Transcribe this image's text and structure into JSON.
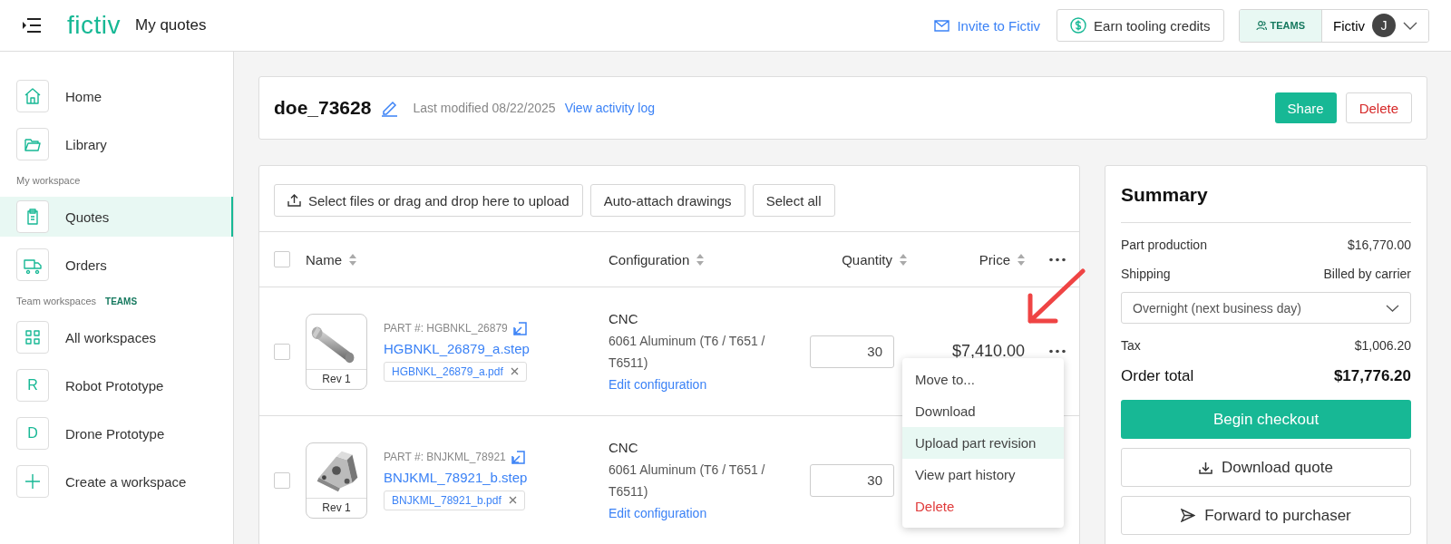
{
  "header": {
    "logo": "fictiv",
    "page_title": "My quotes",
    "invite_link": "Invite to Fictiv",
    "credits_button": "Earn tooling credits",
    "teams_badge": "TEAMS",
    "account_name": "Fictiv",
    "avatar_initial": "J"
  },
  "sidebar": [
    {
      "kind": "home",
      "label": "Home",
      "selected": false
    },
    {
      "kind": "library",
      "label": "Library",
      "selected": false
    },
    {
      "kind": "heading",
      "label": "My workspace"
    },
    {
      "kind": "quotes",
      "label": "Quotes",
      "selected": true
    },
    {
      "kind": "orders",
      "label": "Orders",
      "selected": false
    },
    {
      "kind": "heading",
      "label": "Team workspaces",
      "badge": "TEAMS"
    },
    {
      "kind": "grid",
      "label": "All workspaces",
      "selected": false
    },
    {
      "kind": "letter",
      "initial": "R",
      "label": "Robot Prototype",
      "selected": false
    },
    {
      "kind": "letter",
      "initial": "D",
      "label": "Drone Prototype",
      "selected": false
    },
    {
      "kind": "plus",
      "label": "Create a workspace",
      "selected": false
    }
  ],
  "quote": {
    "name": "doe_73628",
    "modified": "Last modified 08/22/2025",
    "activity_link": "View activity log",
    "share_button": "Share",
    "delete_button": "Delete"
  },
  "toolbar": [
    {
      "kind": "upload",
      "label": "Select files or drag and drop here to upload"
    },
    {
      "kind": "plain",
      "label": "Auto-attach drawings"
    },
    {
      "kind": "plain",
      "label": "Select all"
    }
  ],
  "table": {
    "all_checked": false,
    "columns": [
      "Name",
      "Configuration",
      "Quantity",
      "Price"
    ],
    "rows": [
      {
        "checked": false,
        "revision": "Rev 1",
        "part_number": "PART #: HGBNKL_26879",
        "file": "HGBNKL_26879_a.step",
        "drawing": "HGBNKL_26879_a.pdf",
        "process": "CNC",
        "material": "6061 Aluminum (T6 / T651 / T6511)",
        "edit_link": "Edit configuration",
        "quantity": "30",
        "price": "$7,410.00"
      },
      {
        "checked": false,
        "revision": "Rev 1",
        "part_number": "PART #: BNJKML_78921",
        "file": "BNJKML_78921_b.step",
        "drawing": "BNJKML_78921_b.pdf",
        "process": "CNC",
        "material": "6061 Aluminum (T6 / T651 / T6511)",
        "edit_link": "Edit configuration",
        "quantity": "30"
      }
    ]
  },
  "row_menu": [
    {
      "label": "Move to...",
      "kind": "normal",
      "selected": false
    },
    {
      "label": "Download",
      "kind": "normal",
      "selected": false
    },
    {
      "label": "Upload part revision",
      "kind": "normal",
      "selected": true
    },
    {
      "label": "View part history",
      "kind": "normal",
      "selected": false
    },
    {
      "label": "Delete",
      "kind": "danger",
      "selected": false
    }
  ],
  "summary": {
    "title": "Summary",
    "part_production_label": "Part production",
    "part_production": "$16,770.00",
    "shipping_label": "Shipping",
    "shipping": "Billed by carrier",
    "shipping_option": "Overnight (next business day)",
    "tax_label": "Tax",
    "tax": "$1,006.20",
    "total_label": "Order total",
    "total": "$17,776.20",
    "checkout_button": "Begin checkout",
    "download_button": "Download quote",
    "forward_button": "Forward to purchaser"
  }
}
